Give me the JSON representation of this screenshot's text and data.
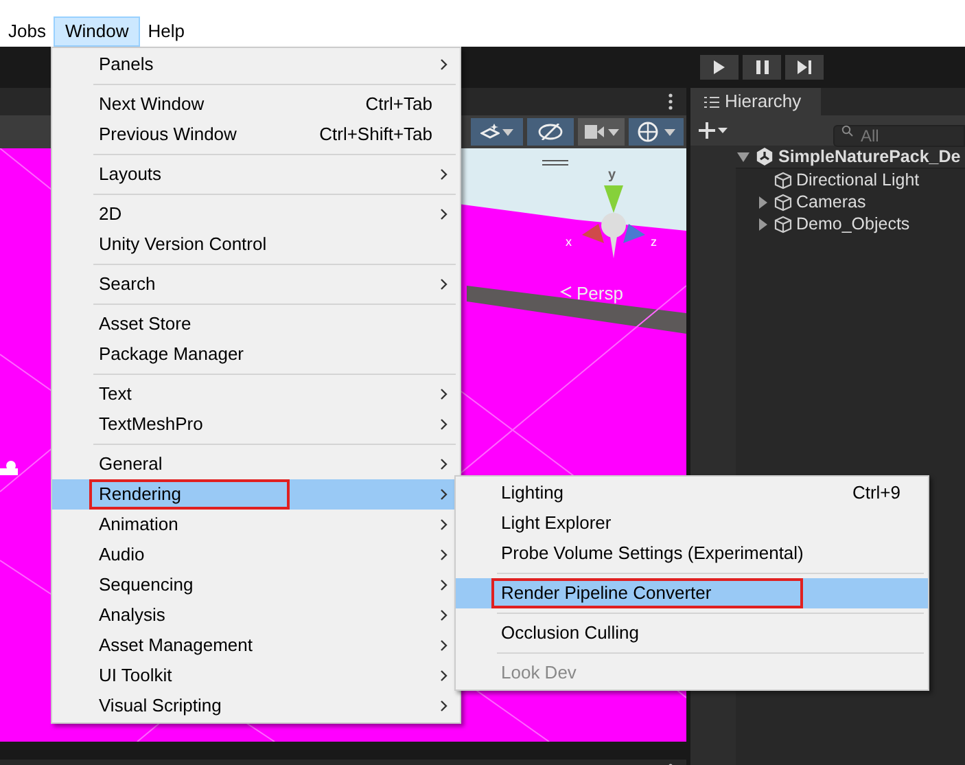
{
  "menubar": [
    {
      "label": "Jobs",
      "selected": false
    },
    {
      "label": "Window",
      "selected": true
    },
    {
      "label": "Help",
      "selected": false
    }
  ],
  "window_menu": {
    "items": [
      {
        "label": "Panels",
        "submenu": true,
        "selected": false,
        "separator_after": true
      },
      {
        "label": "Next Window",
        "shortcut": "Ctrl+Tab",
        "selected": false
      },
      {
        "label": "Previous Window",
        "shortcut": "Ctrl+Shift+Tab",
        "selected": false,
        "separator_after": true
      },
      {
        "label": "Layouts",
        "submenu": true,
        "selected": false,
        "separator_after": true
      },
      {
        "label": "2D",
        "submenu": true,
        "selected": false
      },
      {
        "label": "Unity Version Control",
        "selected": false,
        "separator_after": true
      },
      {
        "label": "Search",
        "submenu": true,
        "selected": false,
        "separator_after": true
      },
      {
        "label": "Asset Store",
        "selected": false
      },
      {
        "label": "Package Manager",
        "selected": false,
        "separator_after": true
      },
      {
        "label": "Text",
        "submenu": true,
        "selected": false
      },
      {
        "label": "TextMeshPro",
        "submenu": true,
        "selected": false,
        "separator_after": true
      },
      {
        "label": "General",
        "submenu": true,
        "selected": false
      },
      {
        "label": "Rendering",
        "submenu": true,
        "selected": true,
        "outlined": true
      },
      {
        "label": "Animation",
        "submenu": true,
        "selected": false
      },
      {
        "label": "Audio",
        "submenu": true,
        "selected": false
      },
      {
        "label": "Sequencing",
        "submenu": true,
        "selected": false
      },
      {
        "label": "Analysis",
        "submenu": true,
        "selected": false
      },
      {
        "label": "Asset Management",
        "submenu": true,
        "selected": false
      },
      {
        "label": "UI Toolkit",
        "submenu": true,
        "selected": false
      },
      {
        "label": "Visual Scripting",
        "submenu": true,
        "selected": false
      }
    ]
  },
  "rendering_submenu": {
    "items": [
      {
        "label": "Lighting",
        "shortcut": "Ctrl+9",
        "selected": false,
        "disabled": false
      },
      {
        "label": "Light Explorer",
        "selected": false,
        "disabled": false
      },
      {
        "label": "Probe Volume Settings (Experimental)",
        "selected": false,
        "disabled": false,
        "separator_after": true
      },
      {
        "label": "Render Pipeline Converter",
        "selected": true,
        "outlined": true,
        "disabled": false,
        "separator_after": true
      },
      {
        "label": "Occlusion Culling",
        "selected": false,
        "disabled": false,
        "separator_after": true
      },
      {
        "label": "Look Dev",
        "selected": false,
        "disabled": true
      }
    ]
  },
  "scene_toolbar": [
    {
      "kind": "layers",
      "on": true
    },
    {
      "kind": "visibility",
      "on": true
    },
    {
      "kind": "camera",
      "on": false
    },
    {
      "kind": "gizmos",
      "on": true
    }
  ],
  "scene_view": {
    "axis_labels": [
      "y",
      "x",
      "z"
    ],
    "projection": "Persp"
  },
  "hierarchy": {
    "tab": "Hierarchy",
    "search": {
      "placeholder": "All"
    },
    "tree": [
      {
        "label": "SimpleNaturePack_De",
        "expanded": true,
        "kind": "scene",
        "selected": false,
        "children": [
          {
            "label": "Directional Light",
            "kind": "object",
            "selected": false
          },
          {
            "label": "Cameras",
            "kind": "object",
            "selected": false,
            "expanded": false
          },
          {
            "label": "Demo_Objects",
            "kind": "object",
            "selected": false,
            "expanded": false
          }
        ]
      }
    ]
  }
}
